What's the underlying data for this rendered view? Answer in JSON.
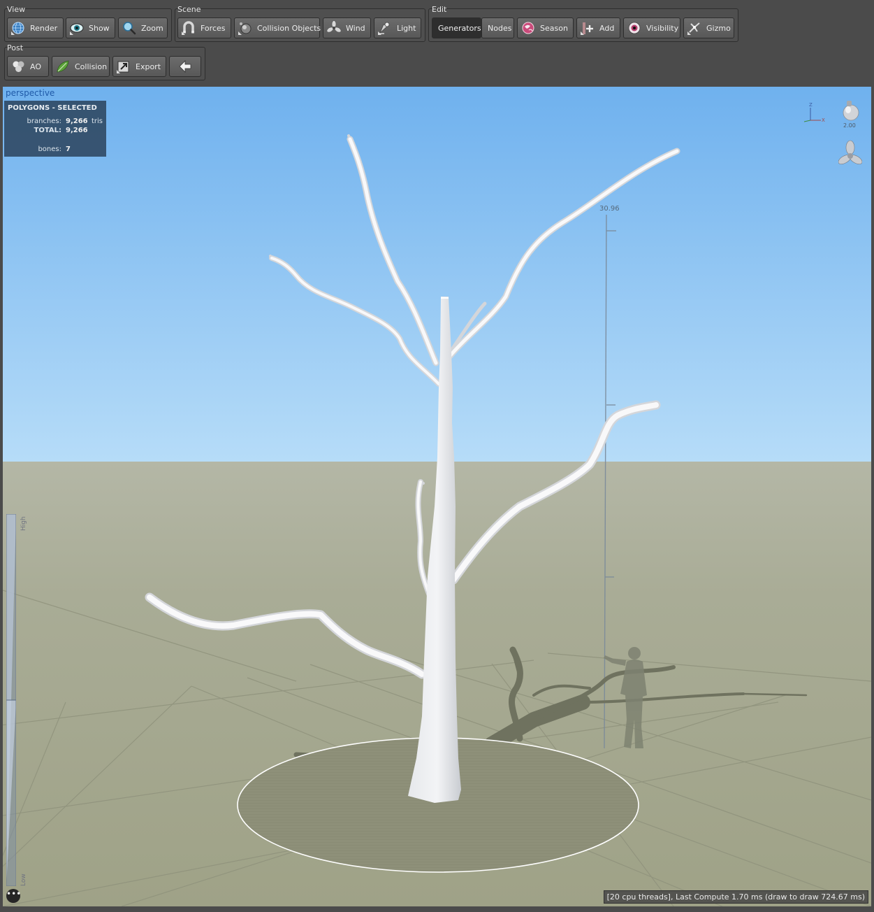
{
  "toolbar": {
    "view": {
      "title": "View",
      "buttons": [
        {
          "label": "Render",
          "icon": "globe-icon"
        },
        {
          "label": "Show",
          "icon": "eye-icon"
        },
        {
          "label": "Zoom",
          "icon": "magnifier-icon"
        }
      ]
    },
    "scene": {
      "title": "Scene",
      "buttons": [
        {
          "label": "Forces",
          "icon": "magnet-icon"
        },
        {
          "label": "Collision Objects",
          "icon": "sphere-icon"
        },
        {
          "label": "Wind",
          "icon": "fan-icon"
        },
        {
          "label": "Light",
          "icon": "lamp-icon"
        }
      ]
    },
    "edit": {
      "title": "Edit",
      "tabs": [
        {
          "label": "Generators",
          "active": true
        },
        {
          "label": "Nodes",
          "active": false
        }
      ],
      "buttons": [
        {
          "label": "Season",
          "icon": "season-icon"
        },
        {
          "label": "Add",
          "icon": "add-icon"
        },
        {
          "label": "Visibility",
          "icon": "visibility-eye-icon"
        },
        {
          "label": "Gizmo",
          "icon": "gizmo-icon"
        }
      ]
    },
    "post": {
      "title": "Post",
      "buttons": [
        {
          "label": "AO",
          "icon": "ao-icon"
        },
        {
          "label": "Collision",
          "icon": "leaf-icon"
        },
        {
          "label": "Export",
          "icon": "export-icon"
        },
        {
          "label": "",
          "icon": "back-arrow-icon"
        }
      ]
    }
  },
  "viewport": {
    "camera_label": "perspective",
    "stats": {
      "header": "POLYGONS - SELECTED",
      "branches_label": "branches:",
      "branches_value": "9,266",
      "branches_unit": "tris",
      "total_label": "TOTAL:",
      "total_value": "9,266",
      "bones_label": "bones:",
      "bones_value": "7"
    },
    "height_scale_label": "30.96",
    "light_intensity": "2.00",
    "axis_labels": {
      "z": "Z",
      "x": "X"
    },
    "lod": {
      "high_label": "High",
      "low_label": "Low"
    },
    "status_text": "[20 cpu threads], Last Compute 1.70 ms (draw to draw 724.67 ms)",
    "more_button": "•••"
  },
  "colors": {
    "sky_top": "#6fb1ee",
    "sky_bottom": "#b6dcf8",
    "ground": "#a4a88e",
    "tree": "#e7e9ec",
    "stats_bg": "#283e55",
    "active_tab": "#2e2e2e"
  }
}
